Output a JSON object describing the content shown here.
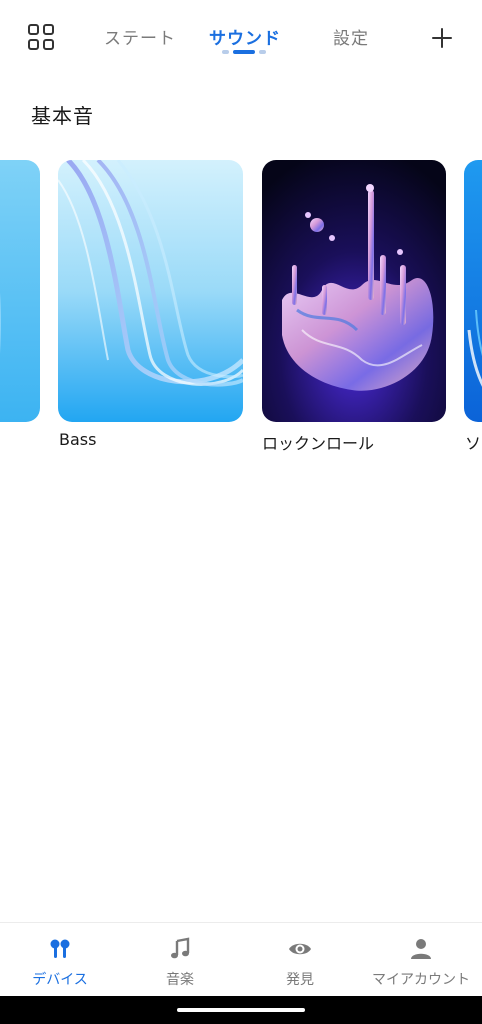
{
  "header": {
    "tabs": [
      {
        "label": "ステート",
        "active": false
      },
      {
        "label": "サウンド",
        "active": true
      },
      {
        "label": "設定",
        "active": false
      }
    ],
    "grid_icon": "grid-icon",
    "add_icon": "plus-icon"
  },
  "section": {
    "title": "基本音",
    "cards": [
      {
        "label": "Bass",
        "artwork": "blue-glass-ribbon"
      },
      {
        "label": "ロックンロール",
        "artwork": "liquid-metal-splash"
      },
      {
        "label": "ソ",
        "artwork": "blue-swirl-partial"
      }
    ]
  },
  "bottom_nav": {
    "items": [
      {
        "label": "デバイス",
        "icon": "earbuds-icon",
        "active": true
      },
      {
        "label": "音楽",
        "icon": "music-note-icon",
        "active": false
      },
      {
        "label": "発見",
        "icon": "eye-icon",
        "active": false
      },
      {
        "label": "マイアカウント",
        "icon": "person-icon",
        "active": false
      }
    ]
  },
  "colors": {
    "accent": "#1a6fe0",
    "inactive": "#7a7a7a",
    "text": "#1a1a1a"
  }
}
